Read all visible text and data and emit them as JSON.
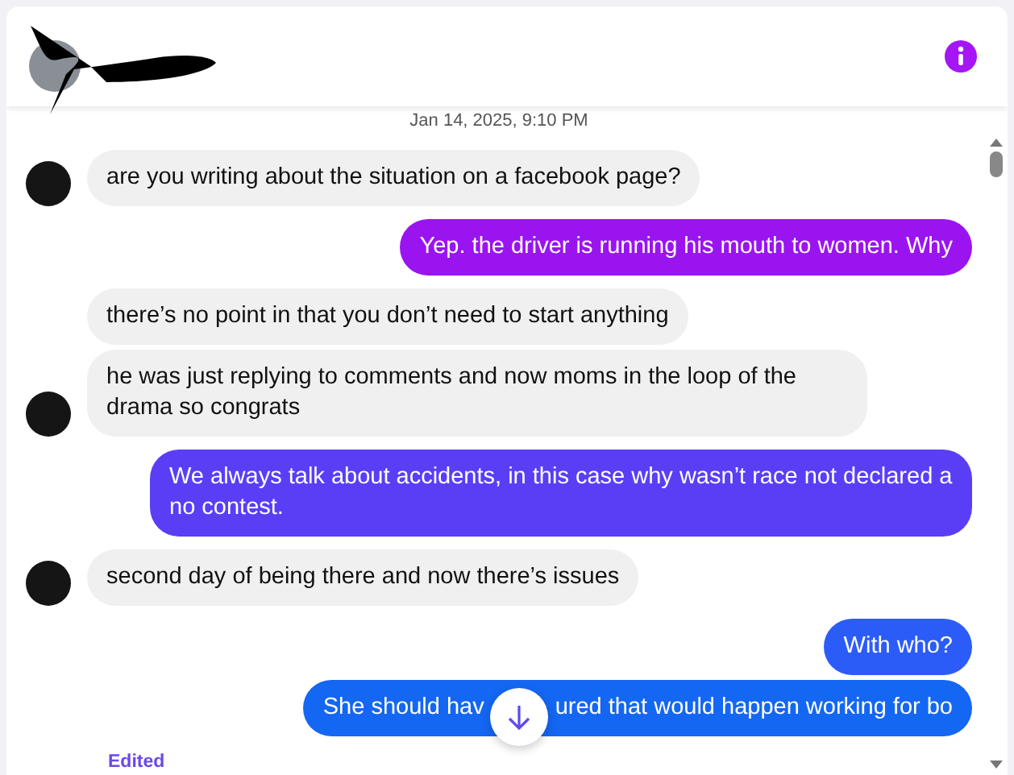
{
  "header": {
    "kind": "redacted"
  },
  "date_divider": "Jan 14, 2025, 9:10 PM",
  "messages": [
    {
      "kind": "incoming",
      "parts": [
        "are you writing about the situation on a facebook page?"
      ]
    },
    {
      "kind": "outgoing",
      "color": "#9a14f0",
      "parts": [
        "Yep. the driver is running his mouth to women. Why"
      ]
    },
    {
      "kind": "incoming",
      "parts": [
        "there’s no point in that you don’t need to start anything"
      ]
    },
    {
      "kind": "incoming",
      "parts": [
        "he was just replying to comments and now moms in the loop of the drama so congrats"
      ]
    },
    {
      "kind": "outgoing",
      "color": "#5a3ef6",
      "parts": [
        "We always talk about accidents, in this case why wasn’t race not declared a no contest."
      ]
    },
    {
      "kind": "incoming",
      "parts": [
        "second day of being there and now there’s issues"
      ]
    },
    {
      "kind": "outgoing",
      "color": "#2b5cf8",
      "parts": [
        "With who?"
      ]
    },
    {
      "kind": "outgoing",
      "color": "#1467f2",
      "parts": [
        "She should hav",
        "ured that would happen working for bo"
      ]
    }
  ],
  "edited_label": "Edited"
}
